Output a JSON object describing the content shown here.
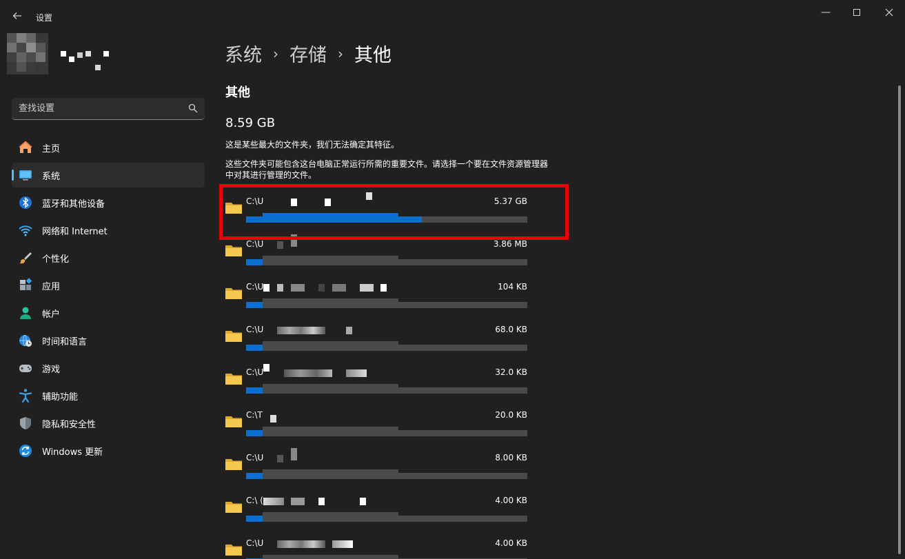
{
  "window": {
    "title": "设置",
    "back_icon": "arrow-left-icon",
    "minimize_icon": "minimize-icon",
    "maximize_icon": "maximize-icon",
    "close_icon": "close-icon"
  },
  "search": {
    "placeholder": "查找设置",
    "icon": "search-icon"
  },
  "sidebar": {
    "items": [
      {
        "label": "主页",
        "icon": "home-icon",
        "active": false
      },
      {
        "label": "系统",
        "icon": "monitor-icon",
        "active": true
      },
      {
        "label": "蓝牙和其他设备",
        "icon": "bluetooth-icon",
        "active": false
      },
      {
        "label": "网络和 Internet",
        "icon": "wifi-icon",
        "active": false
      },
      {
        "label": "个性化",
        "icon": "brush-icon",
        "active": false
      },
      {
        "label": "应用",
        "icon": "apps-icon",
        "active": false
      },
      {
        "label": "帐户",
        "icon": "person-icon",
        "active": false
      },
      {
        "label": "时间和语言",
        "icon": "globe-clock-icon",
        "active": false
      },
      {
        "label": "游戏",
        "icon": "gamepad-icon",
        "active": false
      },
      {
        "label": "辅助功能",
        "icon": "accessibility-icon",
        "active": false
      },
      {
        "label": "隐私和安全性",
        "icon": "shield-icon",
        "active": false
      },
      {
        "label": "Windows 更新",
        "icon": "update-icon",
        "active": false
      }
    ]
  },
  "breadcrumb": {
    "level1": "系统",
    "level2": "存储",
    "current": "其他",
    "separator": "›"
  },
  "section": {
    "title": "其他",
    "total_size": "8.59 GB",
    "description1": "这是某些最大的文件夹，我们无法确定其特征。",
    "description2": "这些文件夹可能包含这台电脑正常运行所需的重要文件。请选择一个要在文件资源管理器中对其进行管理的文件。"
  },
  "folders": [
    {
      "path": "C:\\U",
      "size": "5.37 GB",
      "fraction": 0.625
    },
    {
      "path": "C:\\U",
      "size": "3.86 MB",
      "fraction": 0.004
    },
    {
      "path": "C:\\U",
      "size": "104 KB",
      "fraction": 0.004
    },
    {
      "path": "C:\\U",
      "size": "68.0 KB",
      "fraction": 0.004
    },
    {
      "path": "C:\\U",
      "size": "32.0 KB",
      "fraction": 0.004
    },
    {
      "path": "C:\\T",
      "size": "20.0 KB",
      "fraction": 0.004
    },
    {
      "path": "C:\\U",
      "size": "8.00 KB",
      "fraction": 0.004
    },
    {
      "path": "C:\\ (",
      "size": "4.00 KB",
      "fraction": 0.004
    },
    {
      "path": "C:\\U",
      "size": "4.00 KB",
      "fraction": 0.004
    }
  ],
  "colors": {
    "background": "#202020",
    "accent": "#0a6fcf",
    "highlight": "#e8000b",
    "folder": "#f2c14e"
  }
}
